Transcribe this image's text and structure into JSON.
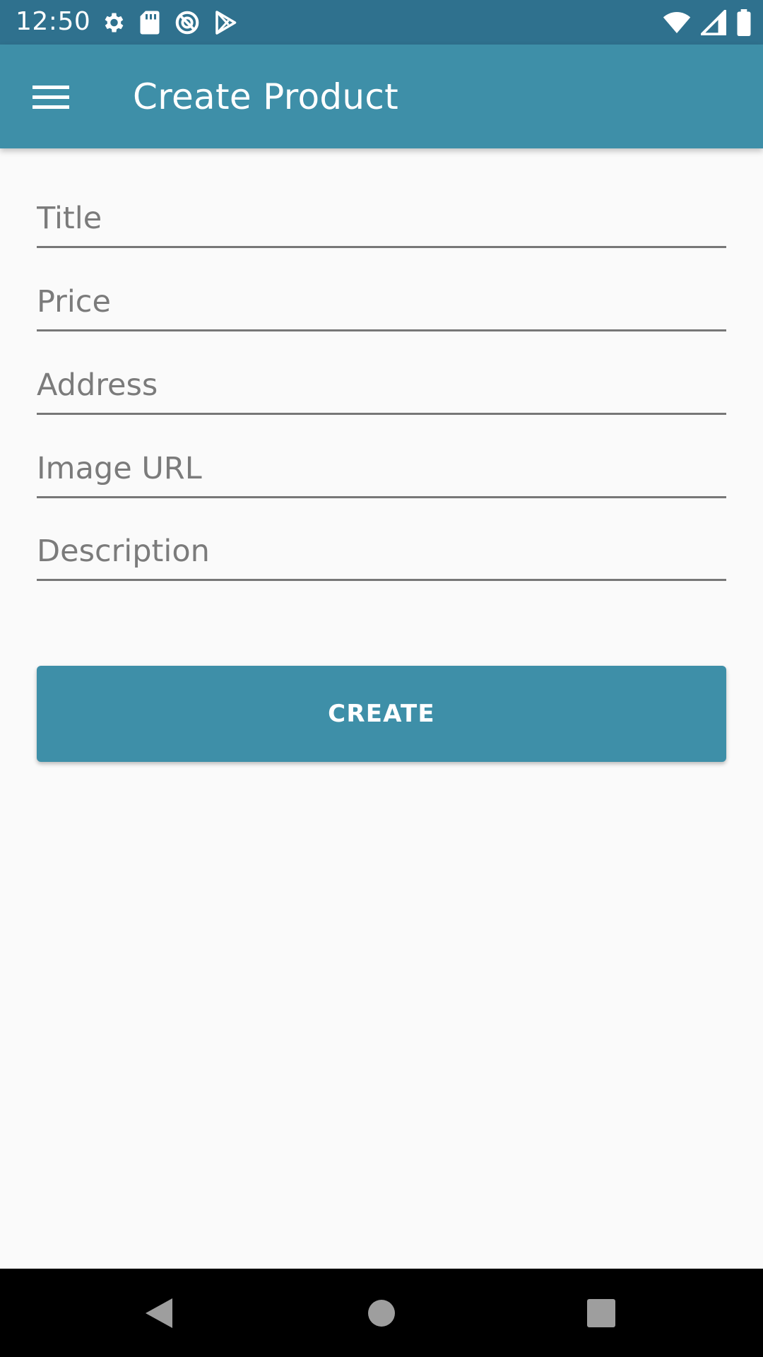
{
  "status_bar": {
    "time": "12:50",
    "left_icons": [
      "settings-icon",
      "sd-card-icon",
      "vpn-icon",
      "play-store-icon"
    ],
    "right_icons": [
      "wifi-icon",
      "cellular-icon",
      "battery-icon"
    ]
  },
  "app_bar": {
    "title": "Create Product",
    "menu_icon": "hamburger-menu-icon"
  },
  "form": {
    "fields": [
      {
        "placeholder": "Title",
        "value": ""
      },
      {
        "placeholder": "Price",
        "value": ""
      },
      {
        "placeholder": "Address",
        "value": ""
      },
      {
        "placeholder": "Image URL",
        "value": ""
      },
      {
        "placeholder": "Description",
        "value": ""
      }
    ],
    "submit_label": "CREATE"
  },
  "nav_bar": {
    "buttons": [
      "back-icon",
      "home-icon",
      "recents-icon"
    ]
  },
  "colors": {
    "status_bar": "#2f718e",
    "app_bar": "#3e8fa8",
    "button": "#3e8fa8",
    "background": "#fafafa"
  }
}
